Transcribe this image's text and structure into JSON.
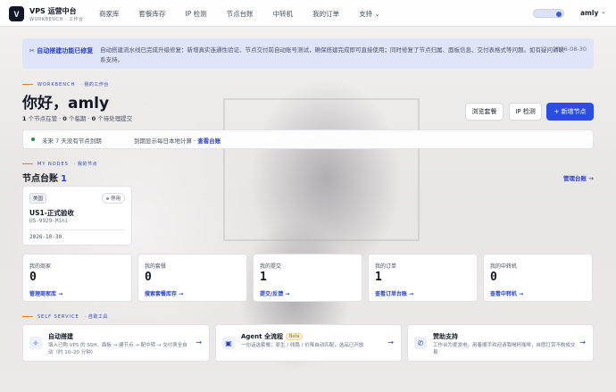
{
  "nav": {
    "logo_letter": "V",
    "brand_title": "VPS 运营中台",
    "brand_sub": "WORKBENCH · 工作台",
    "items": [
      "商家库",
      "套餐库存",
      "IP 检测",
      "节点台账",
      "中转机",
      "我的订单",
      "支持"
    ],
    "support_chevron": "⌄",
    "user": "amly",
    "user_chevron": "⌄"
  },
  "notice": {
    "tag": "✂ 自动搭建功能已修复",
    "text": "自动搭建流水线已完成升级修复：新增真实连通性验证、节点交付前自动账号测试，确保搭建完成即可直接使用；同时修复了节点归属、面板信息、交付表格式等问题。如有疑问请联系支持。",
    "date": "2026-08-30"
  },
  "workbench": {
    "eyebrow": "WORKBENCH",
    "eyebrow_sub": "· 我的工作台",
    "greeting": "你好，amly",
    "stats": {
      "nodes_count": "1",
      "nodes_label": " 个节点在管 · ",
      "expired_count": "0",
      "expired_label": " 个临期 · ",
      "pending_count": "0",
      "pending_label": " 个待处理提交"
    },
    "buttons": {
      "browse": "浏览套餐",
      "ip_check": "IP 检测",
      "add_node": "+ 新增节点"
    }
  },
  "status": {
    "main": "未来 7 天没有节点到期",
    "sub": "到期显示每日本地计算 · ",
    "link": "查看台账"
  },
  "nodes_section": {
    "eyebrow": "MY NODES",
    "eyebrow_sub": "· 我的节点",
    "title": "节点台账",
    "count": "1",
    "manage_link": "管理台账 →",
    "node": {
      "region": "美国",
      "state": "停用",
      "name": "US1-正式验收",
      "model": "US-9929-Mini",
      "date": "2026-10-30"
    }
  },
  "stat_cards": [
    {
      "label": "我的商家",
      "value": "0",
      "link": "管理商家库 →"
    },
    {
      "label": "我的套餐",
      "value": "0",
      "link": "搜索套餐库存 →"
    },
    {
      "label": "我的提交",
      "value": "1",
      "link": "提交/反馈 →"
    },
    {
      "label": "我的订单",
      "value": "1",
      "link": "查看订单台账 →"
    },
    {
      "label": "我的中转机",
      "value": "0",
      "link": "查看中转机 →"
    }
  ],
  "self_service": {
    "eyebrow": "SELF SERVICE",
    "eyebrow_sub": "· 自助工具",
    "cards": [
      {
        "icon": "✧",
        "title": "自动搭建",
        "badge": "",
        "desc": "填入已购 VPS 的 SSH、面板 → 建节点 → 配中转 → 交付表全自动（约 10–20 分钟）",
        "arrow": "→"
      },
      {
        "icon": "▣",
        "title": "Agent 全流程",
        "badge": "Beta",
        "desc": "一句话选套餐：原生 / 线路 / 价降自动匹配，选品已开放",
        "arrow": "→"
      },
      {
        "icon": "✆",
        "title": "赞助支持",
        "badge": "",
        "desc": "工作台为爱发电。用着顺手欢迎请我喝杯咖啡，自愿打赏不构成交易",
        "arrow": "→"
      }
    ]
  }
}
